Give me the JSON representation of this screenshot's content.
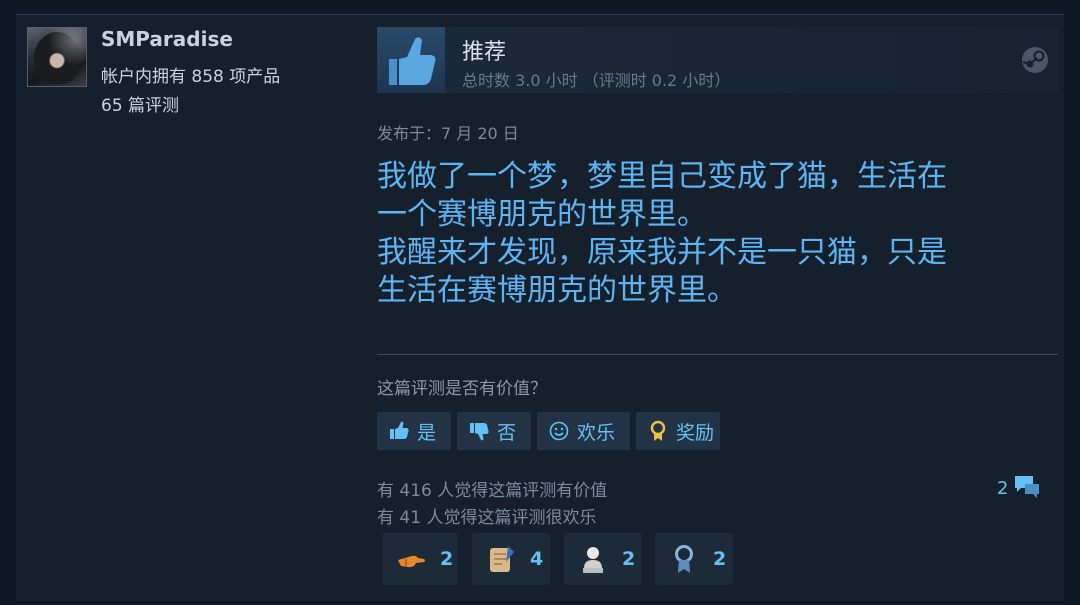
{
  "author": {
    "name": "SMParadise",
    "products": "帐户内拥有 858 项产品",
    "reviews": "65 篇评测"
  },
  "review": {
    "recommendation": "推荐",
    "hours": "总时数 3.0 小时 （评测时 0.2 小时）",
    "posted": "发布于：7 月 20 日",
    "text": "我做了一个梦，梦里自己变成了猫，生活在\n一个赛博朋克的世界里。\n我醒来才发现，原来我并不是一只猫，只是\n生活在赛博朋克的世界里。"
  },
  "helpful": {
    "question": "这篇评测是否有价值？",
    "yes_label": "是",
    "no_label": "否",
    "funny_label": "欢乐",
    "award_label": "奖励"
  },
  "stats": {
    "helpful_count": "有 416 人觉得这篇评测有价值",
    "funny_count": "有 41 人觉得这篇评测很欢乐",
    "comment_count": "2"
  },
  "awards": [
    {
      "icon": "pointing-hand-icon",
      "count": "2"
    },
    {
      "icon": "scroll-quill-icon",
      "count": "4"
    },
    {
      "icon": "bust-statue-icon",
      "count": "2"
    },
    {
      "icon": "ribbon-medal-icon",
      "count": "2"
    }
  ],
  "colors": {
    "background": "#16202d",
    "accent": "#66c0f4",
    "review_text": "#5eb4f2"
  }
}
